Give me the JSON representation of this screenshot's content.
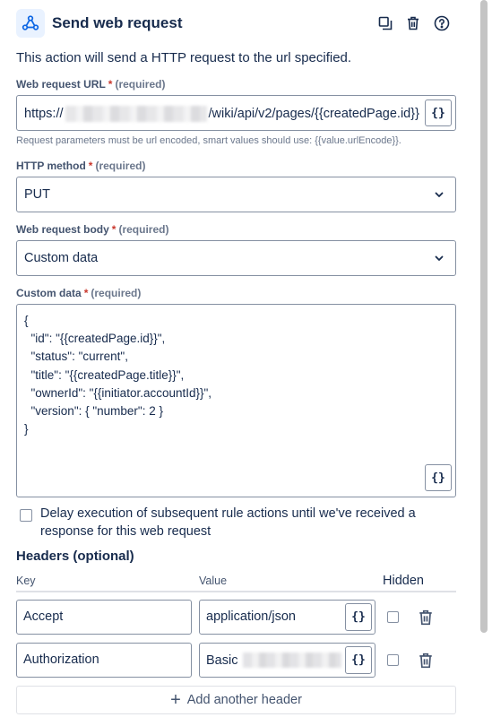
{
  "header": {
    "title": "Send web request",
    "icons": [
      "webhook-icon",
      "copy-icon",
      "trash-icon",
      "help-icon"
    ]
  },
  "description": "This action will send a HTTP request to the url specified.",
  "url_field": {
    "label": "Web request URL",
    "required_mark": "*",
    "required_text": "(required)",
    "value_prefix": "https://",
    "value_suffix": "/wiki/api/v2/pages/{{createdPage.id}}",
    "smart_value_button": "{}",
    "help": "Request parameters must be url encoded, smart values should use: {{value.urlEncode}}."
  },
  "method_field": {
    "label": "HTTP method",
    "required_mark": "*",
    "required_text": "(required)",
    "value": "PUT"
  },
  "body_field": {
    "label": "Web request body",
    "required_mark": "*",
    "required_text": "(required)",
    "value": "Custom data"
  },
  "custom_data": {
    "label": "Custom data",
    "required_mark": "*",
    "required_text": "(required)",
    "value": "{\n  \"id\": \"{{createdPage.id}}\",\n  \"status\": \"current\",\n  \"title\": \"{{createdPage.title}}\",\n  \"ownerId\": \"{{initiator.accountId}}\",\n  \"version\": { \"number\": 2 }\n}",
    "smart_value_button": "{}"
  },
  "delay": {
    "checked": false,
    "label": "Delay execution of subsequent rule actions until we've received a response for this web request"
  },
  "headers": {
    "title": "Headers (optional)",
    "col_key": "Key",
    "col_value": "Value",
    "col_hidden": "Hidden",
    "rows": [
      {
        "key": "Accept",
        "value": "application/json",
        "hidden": false,
        "button": "{}"
      },
      {
        "key": "Authorization",
        "value": "Basic",
        "hidden": false,
        "button": "{}"
      }
    ],
    "add_button": "Add another header",
    "add_icon": "+"
  },
  "colors": {
    "accent_bg": "#e9f2ff",
    "accent": "#0c66e4",
    "required": "#c9372c",
    "text": "#172b4d",
    "border": "#8590a2"
  }
}
